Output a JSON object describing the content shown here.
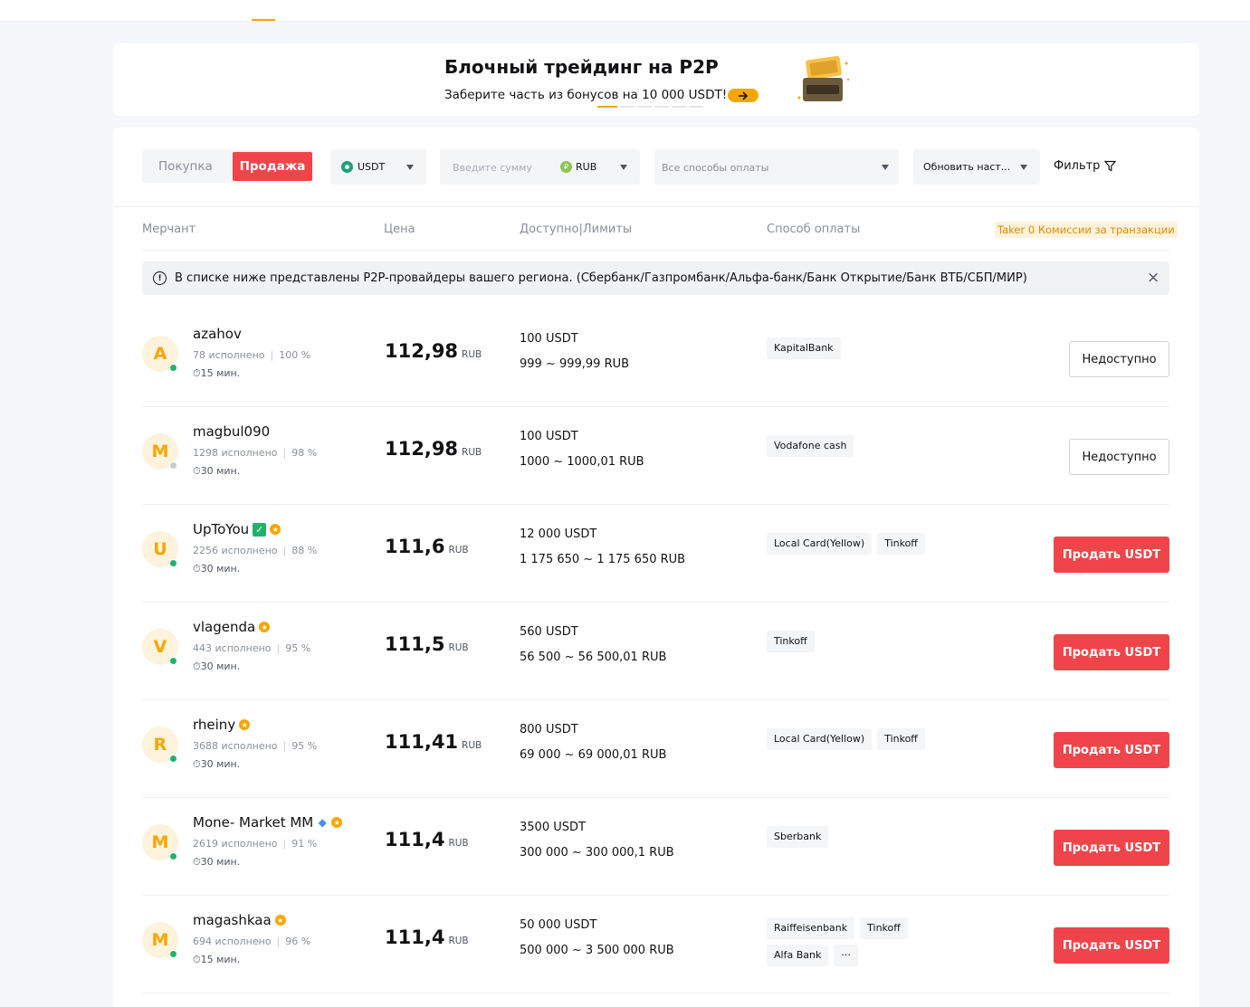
{
  "banner": {
    "title": "Блочный трейдинг на P2P",
    "subtitle": "Заберите часть из бонусов на 10 000 USDT!",
    "image_label": "10,000 USDT"
  },
  "controls": {
    "buy_label": "Покупка",
    "sell_label": "Продажа",
    "coin": "USDT",
    "amount_placeholder": "Введите сумму",
    "fiat": "RUB",
    "payment_placeholder": "Все способы оплаты",
    "refresh_label": "Обновить наст...",
    "filter_label": "Фильтр"
  },
  "table_headers": {
    "merchant": "Мерчант",
    "price": "Цена",
    "available": "Доступно|Лимиты",
    "payment": "Способ оплаты",
    "taker": "Taker 0 Комиссии за транзакции"
  },
  "notice": "В списке ниже представлены P2P-провайдеры вашего региона. (Сбербанк/Газпромбанк/Альфа-банк/Банк Открытие/Банк ВТБ/СБП/МИР)",
  "rows": [
    {
      "initial": "A",
      "name": "azahov",
      "online": true,
      "verified": false,
      "diamond": false,
      "gold": false,
      "completed": "78 исполнено",
      "rate": "100 %",
      "time": "15 мин.",
      "price": "112,98",
      "currency": "RUB",
      "available": "100 USDT",
      "limits": "999 ~ 999,99 RUB",
      "payments": [
        "KapitalBank"
      ],
      "action": "Недоступно",
      "action_enabled": false
    },
    {
      "initial": "M",
      "name": "magbul090",
      "online": false,
      "verified": false,
      "diamond": false,
      "gold": false,
      "completed": "1298 исполнено",
      "rate": "98 %",
      "time": "30 мин.",
      "price": "112,98",
      "currency": "RUB",
      "available": "100 USDT",
      "limits": "1000 ~ 1000,01 RUB",
      "payments": [
        "Vodafone cash"
      ],
      "action": "Недоступно",
      "action_enabled": false
    },
    {
      "initial": "U",
      "name": "UpToYou",
      "online": true,
      "verified": true,
      "diamond": false,
      "gold": true,
      "completed": "2256 исполнено",
      "rate": "88 %",
      "time": "30 мин.",
      "price": "111,6",
      "currency": "RUB",
      "available": "12 000 USDT",
      "limits": "1 175 650 ~ 1 175 650 RUB",
      "payments": [
        "Local Card(Yellow)",
        "Tinkoff"
      ],
      "action": "Продать USDT",
      "action_enabled": true
    },
    {
      "initial": "V",
      "name": "vlagenda",
      "online": true,
      "verified": false,
      "diamond": false,
      "gold": true,
      "completed": "443 исполнено",
      "rate": "95 %",
      "time": "30 мин.",
      "price": "111,5",
      "currency": "RUB",
      "available": "560 USDT",
      "limits": "56 500 ~ 56 500,01 RUB",
      "payments": [
        "Tinkoff"
      ],
      "action": "Продать USDT",
      "action_enabled": true
    },
    {
      "initial": "R",
      "name": "rheiny",
      "online": true,
      "verified": false,
      "diamond": false,
      "gold": true,
      "completed": "3688 исполнено",
      "rate": "95 %",
      "time": "30 мин.",
      "price": "111,41",
      "currency": "RUB",
      "available": "800 USDT",
      "limits": "69 000 ~ 69 000,01 RUB",
      "payments": [
        "Local Card(Yellow)",
        "Tinkoff"
      ],
      "action": "Продать USDT",
      "action_enabled": true
    },
    {
      "initial": "M",
      "name": "Mone- Market MM",
      "online": true,
      "verified": false,
      "diamond": true,
      "gold": true,
      "completed": "2619 исполнено",
      "rate": "91 %",
      "time": "30 мин.",
      "price": "111,4",
      "currency": "RUB",
      "available": "3500 USDT",
      "limits": "300 000 ~ 300 000,1 RUB",
      "payments": [
        "Sberbank"
      ],
      "action": "Продать USDT",
      "action_enabled": true
    },
    {
      "initial": "M",
      "name": "magashkaa",
      "online": true,
      "verified": false,
      "diamond": false,
      "gold": true,
      "completed": "694 исполнено",
      "rate": "96 %",
      "time": "15 мин.",
      "price": "111,4",
      "currency": "RUB",
      "available": "50 000 USDT",
      "limits": "500 000 ~ 3 500 000 RUB",
      "payments": [
        "Raiffeisenbank",
        "Tinkoff",
        "Alfa Bank",
        "···"
      ],
      "action": "Продать USDT",
      "action_enabled": true
    }
  ],
  "colors": {
    "accent": "#f7a600",
    "sell": "#ef454a",
    "online": "#20b26c",
    "verified": "#20b26c"
  },
  "icons": {
    "timer": "⏱",
    "filter": "filter-icon",
    "info": "info-icon",
    "close": "close-icon"
  }
}
